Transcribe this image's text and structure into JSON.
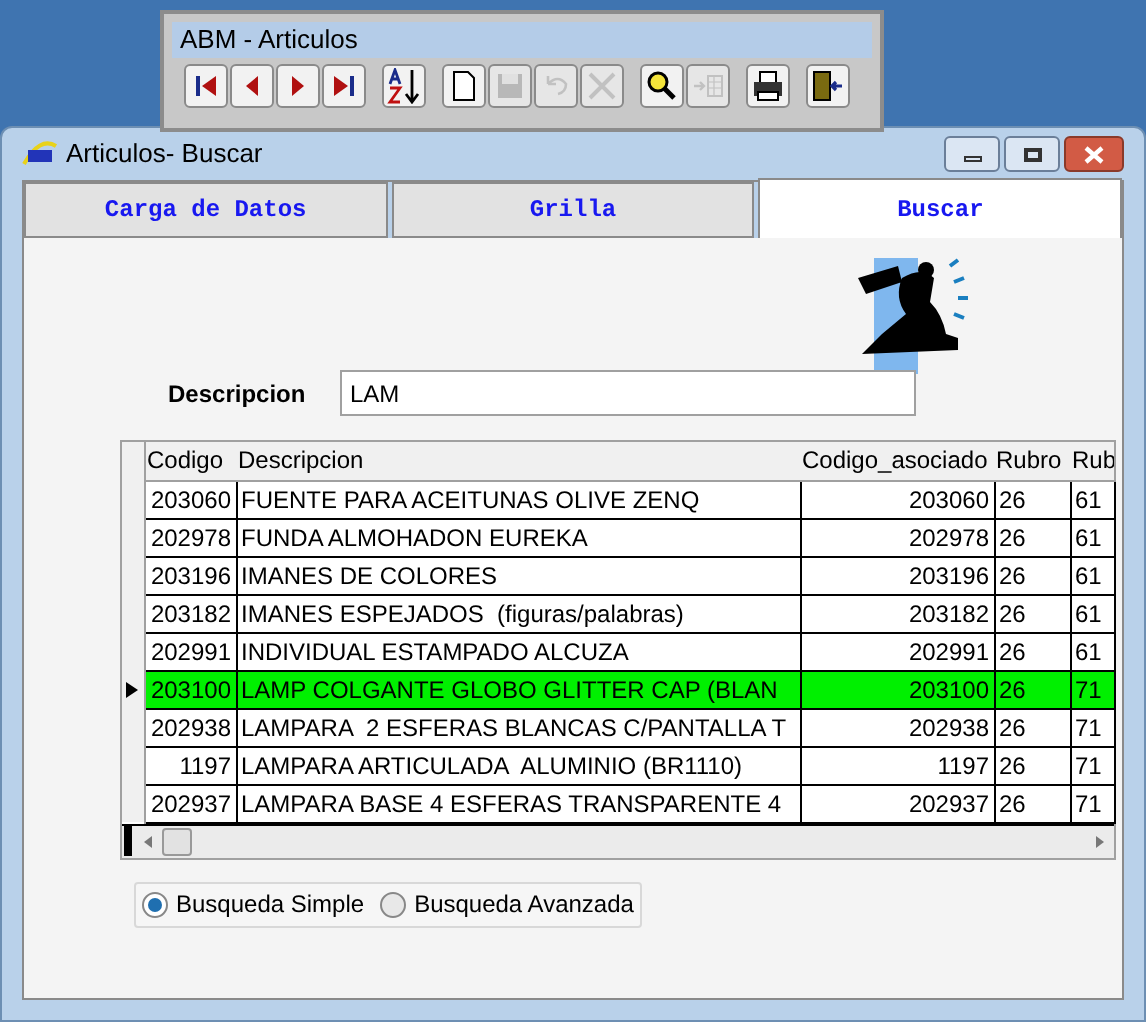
{
  "toolbar": {
    "title": "ABM - Articulos",
    "groups": [
      [
        {
          "kind": "first",
          "disabled": false
        },
        {
          "kind": "prev",
          "disabled": false
        },
        {
          "kind": "next",
          "disabled": false
        },
        {
          "kind": "last",
          "disabled": false
        }
      ],
      [
        {
          "kind": "sort",
          "disabled": false
        }
      ],
      [
        {
          "kind": "new",
          "disabled": false
        },
        {
          "kind": "save",
          "disabled": true
        },
        {
          "kind": "undo",
          "disabled": true
        },
        {
          "kind": "delete",
          "disabled": true
        }
      ],
      [
        {
          "kind": "search",
          "disabled": false
        },
        {
          "kind": "insert",
          "disabled": true
        }
      ],
      [
        {
          "kind": "print",
          "disabled": false
        }
      ],
      [
        {
          "kind": "exit",
          "disabled": false
        }
      ]
    ]
  },
  "window": {
    "title": "Articulos- Buscar"
  },
  "tabs": [
    {
      "label": "Carga de Datos",
      "selected": false
    },
    {
      "label": "Grilla",
      "selected": false
    },
    {
      "label": "Buscar",
      "selected": true
    }
  ],
  "search": {
    "label": "Descripcion",
    "value": "LAM"
  },
  "table": {
    "columns": [
      "Codigo",
      "Descripcion",
      "Codigo_asociado",
      "Rubro",
      "Rub"
    ],
    "rows": [
      {
        "cells": [
          "203060",
          "FUENTE PARA ACEITUNAS OLIVE ZENQ",
          "203060",
          "26",
          "61"
        ],
        "selected": false
      },
      {
        "cells": [
          "202978",
          "FUNDA ALMOHADON EUREKA",
          "202978",
          "26",
          "61"
        ],
        "selected": false
      },
      {
        "cells": [
          "203196",
          "IMANES DE COLORES",
          "203196",
          "26",
          "61"
        ],
        "selected": false
      },
      {
        "cells": [
          "203182",
          "IMANES ESPEJADOS  (figuras/palabras)",
          "203182",
          "26",
          "61"
        ],
        "selected": false
      },
      {
        "cells": [
          "202991",
          "INDIVIDUAL ESTAMPADO ALCUZA",
          "202991",
          "26",
          "61"
        ],
        "selected": false
      },
      {
        "cells": [
          "203100",
          "LAMP COLGANTE GLOBO GLITTER CAP (BLAN",
          "203100",
          "26",
          "71"
        ],
        "selected": true
      },
      {
        "cells": [
          "202938",
          "LAMPARA  2 ESFERAS BLANCAS C/PANTALLA T",
          "202938",
          "26",
          "71"
        ],
        "selected": false
      },
      {
        "cells": [
          "1197",
          "LAMPARA ARTICULADA  ALUMINIO (BR1110)",
          "1197",
          "26",
          "71"
        ],
        "selected": false
      },
      {
        "cells": [
          "202937",
          "LAMPARA BASE 4 ESFERAS TRANSPARENTE 4",
          "202937",
          "26",
          "71"
        ],
        "selected": false
      }
    ]
  },
  "search_mode": [
    {
      "label": "Busqueda Simple",
      "selected": true
    },
    {
      "label": "Busqueda Avanzada",
      "selected": false
    }
  ]
}
